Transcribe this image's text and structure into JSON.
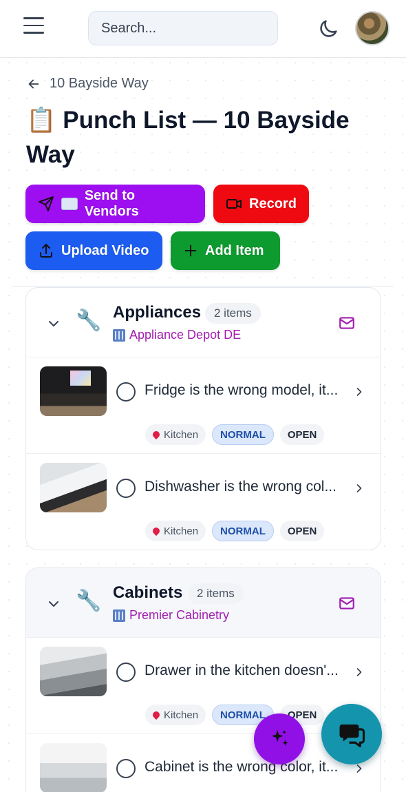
{
  "header": {
    "search_placeholder": "Search...",
    "icons": [
      "menu-icon",
      "moon-icon",
      "avatar"
    ]
  },
  "breadcrumb": {
    "back_label": "10 Bayside Way"
  },
  "page": {
    "title": "📋 Punch List — 10 Bayside Way"
  },
  "actions": {
    "send_label": "Send to Vendors",
    "record_label": "Record",
    "upload_label": "Upload Video",
    "add_label": "Add Item"
  },
  "colors": {
    "send": "#9d0ff0",
    "record": "#ef0a12",
    "upload": "#1d5cf0",
    "add": "#0d9a2e",
    "vendor_text": "#a21caf",
    "fab_sparkle": "#9010e6",
    "fab_chat": "#1594ad"
  },
  "groups": [
    {
      "name": "Appliances",
      "count": "2 items",
      "vendor": "Appliance Depot DE",
      "items": [
        {
          "title": "Fridge is the wrong model, it...",
          "location": "Kitchen",
          "priority": "NORMAL",
          "status": "OPEN"
        },
        {
          "title": "Dishwasher is the wrong col...",
          "location": "Kitchen",
          "priority": "NORMAL",
          "status": "OPEN"
        }
      ]
    },
    {
      "name": "Cabinets",
      "count": "2 items",
      "vendor": "Premier Cabinetry",
      "items": [
        {
          "title": "Drawer in the kitchen doesn'...",
          "location": "Kitchen",
          "priority": "NORMAL",
          "status": "OPEN"
        },
        {
          "title": "Cabinet is the wrong color, it...",
          "location": "",
          "priority": "",
          "status": ""
        }
      ]
    }
  ]
}
